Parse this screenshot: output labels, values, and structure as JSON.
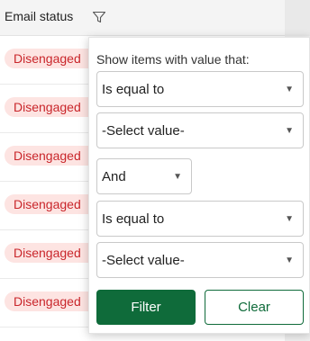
{
  "header": {
    "column_label": "Email status",
    "filter_icon": "filter-funnel-icon"
  },
  "rows": [
    {
      "status": "Disengaged"
    },
    {
      "status": "Disengaged"
    },
    {
      "status": "Disengaged"
    },
    {
      "status": "Disengaged"
    },
    {
      "status": "Disengaged"
    },
    {
      "status": "Disengaged"
    }
  ],
  "filter_popup": {
    "title": "Show items with value that:",
    "operator_1": "Is equal to",
    "value_1": "-Select value-",
    "logic": "And",
    "operator_2": "Is equal to",
    "value_2": "-Select value-",
    "filter_button": "Filter",
    "clear_button": "Clear"
  },
  "colors": {
    "badge_bg": "#fde4e2",
    "badge_text": "#c9262b",
    "primary": "#0f6b3a"
  }
}
